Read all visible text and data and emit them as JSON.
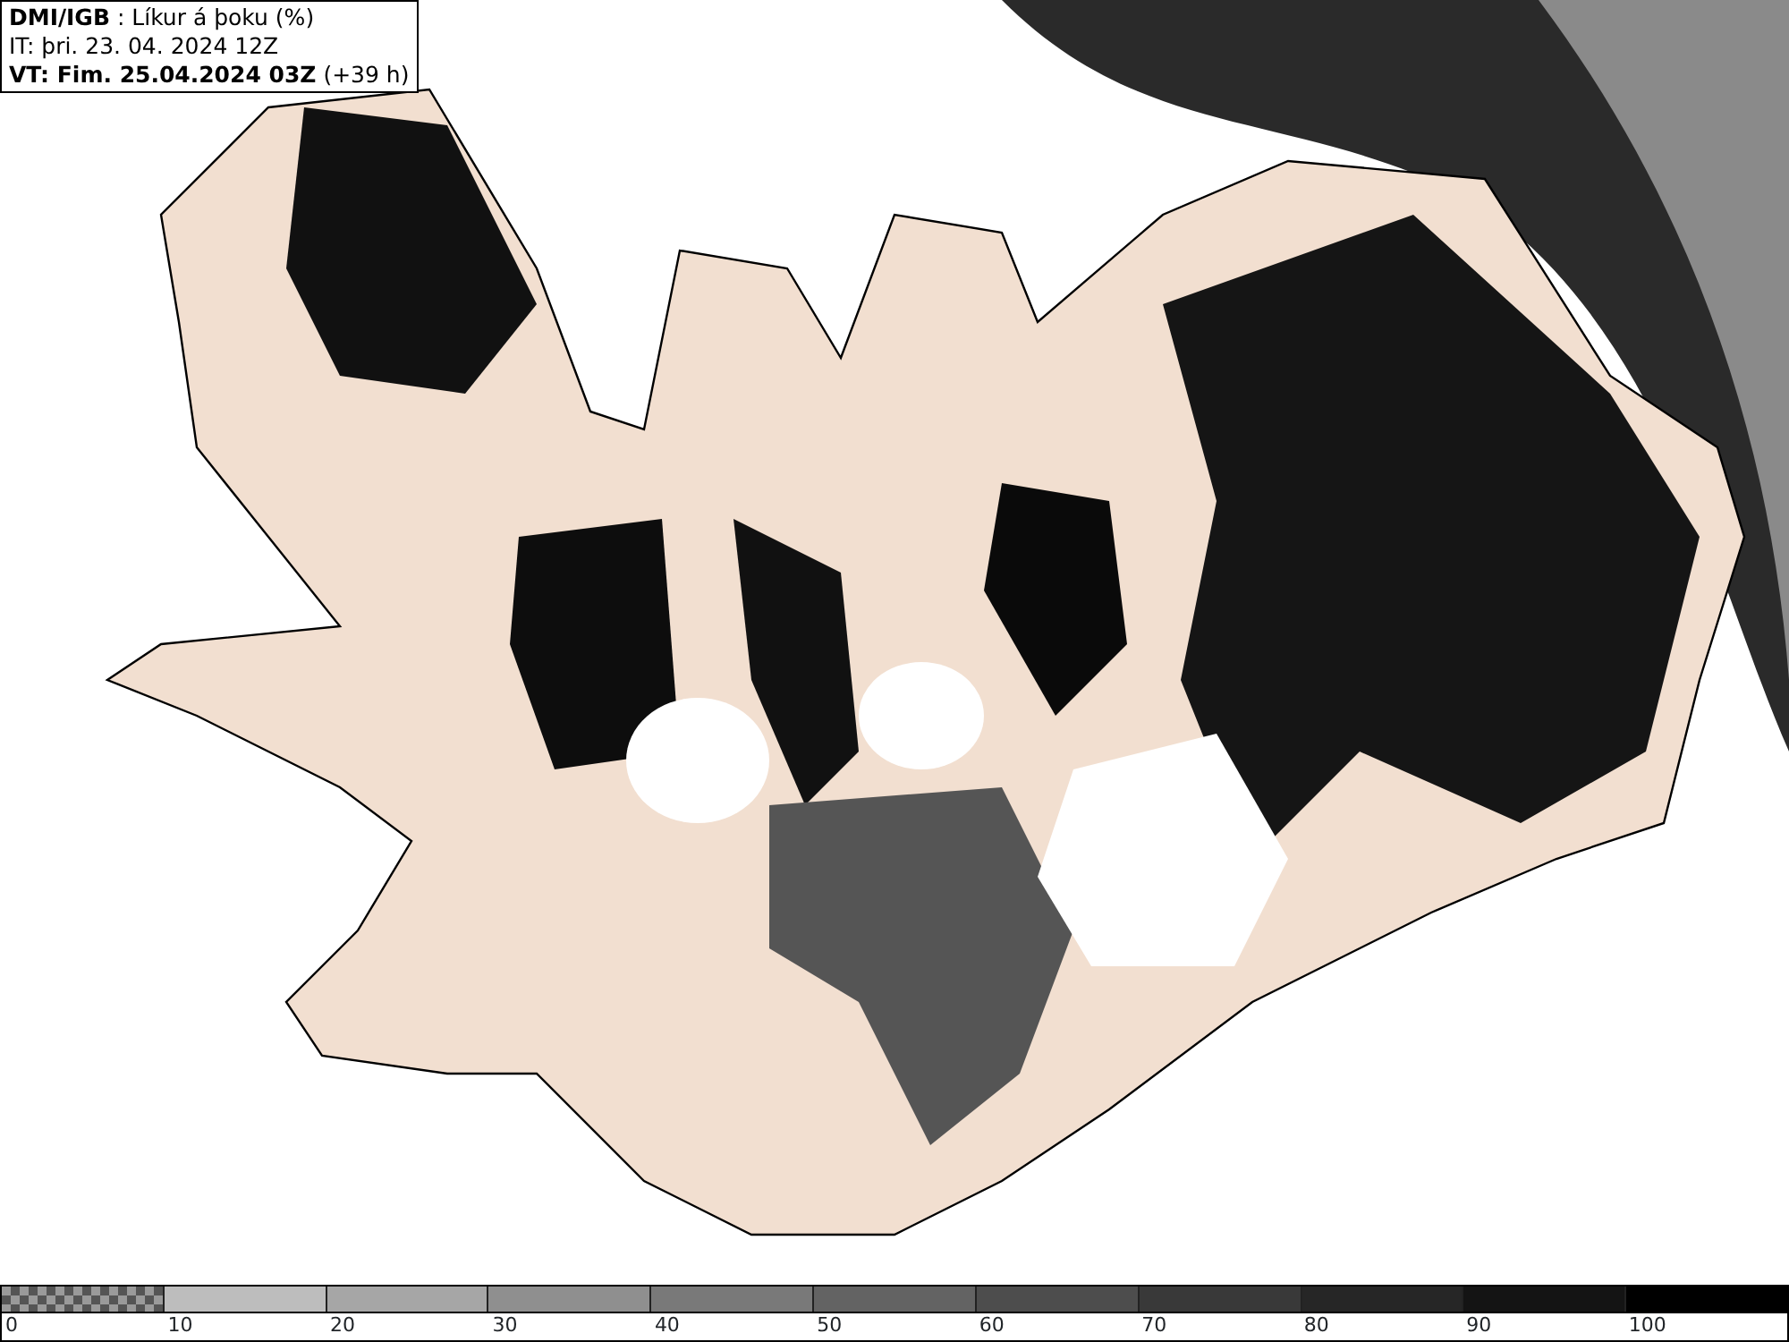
{
  "info_box": {
    "lines": [
      "**DMI/IGB** : Líkur á þoku (%)",
      "IT: þri. 23. 04. 2024 12Z",
      "**VT: Fim. 25.04.2024 03Z** (+39 h)"
    ]
  },
  "legend": {
    "segments": [
      {
        "kind": "checker",
        "color": "#555555",
        "label": "0"
      },
      {
        "kind": "solid",
        "color": "#bdbdbd",
        "label": "10"
      },
      {
        "kind": "solid",
        "color": "#a6a6a6",
        "label": "20"
      },
      {
        "kind": "solid",
        "color": "#8f8f8f",
        "label": "30"
      },
      {
        "kind": "solid",
        "color": "#797979",
        "label": "40"
      },
      {
        "kind": "solid",
        "color": "#636363",
        "label": "50"
      },
      {
        "kind": "solid",
        "color": "#4d4d4d",
        "label": "60"
      },
      {
        "kind": "solid",
        "color": "#393939",
        "label": "70"
      },
      {
        "kind": "solid",
        "color": "#262626",
        "label": "80"
      },
      {
        "kind": "solid",
        "color": "#141414",
        "label": "90"
      },
      {
        "kind": "solid",
        "color": "#000000",
        "label": "100"
      }
    ]
  }
}
